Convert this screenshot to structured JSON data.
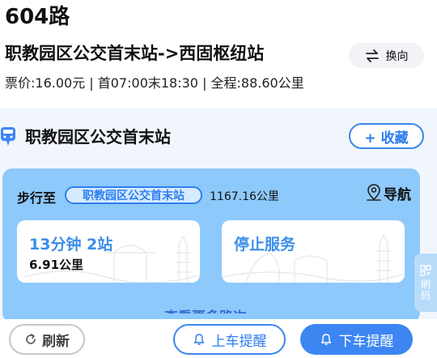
{
  "route": {
    "title": "604路"
  },
  "direction": {
    "text": "职教园区公交首末站->西固枢纽站",
    "swap_label": "换向"
  },
  "info": {
    "line": "票价:16.00元 | 首07:00末18:30 | 全程:88.60公里"
  },
  "stop": {
    "name": "职教园区公交首末站",
    "fav_label": "+ 收藏"
  },
  "walk": {
    "label": "步行至",
    "stop_name": "职教园区公交首末站",
    "distance": "1167.16公里",
    "nav_label": "导航"
  },
  "buses": [
    {
      "main": "13分钟 2站",
      "sub": "6.91公里"
    },
    {
      "main": "停止服务",
      "sub": ""
    }
  ],
  "more_hint": "查看更多路次",
  "side_tab": {
    "label_1": "刷",
    "label_2": "码"
  },
  "bottom": {
    "refresh_label": "刷新",
    "board_label": "上车提醒",
    "alight_label": "下车提醒"
  },
  "colors": {
    "accent": "#3d86f2",
    "panel_bg": "#f1f6fc",
    "card_bg": "#8dc9fb",
    "eta_text": "#3b8ee8"
  }
}
